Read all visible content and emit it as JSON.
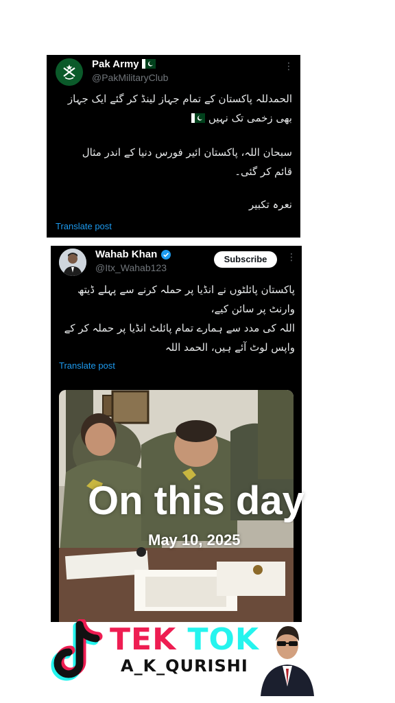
{
  "post1": {
    "name": "Pak Army",
    "handle": "@PakMilitaryClub",
    "line1": "الحمدللہ پاکستان کے تمام جہاز لینڈ کر گئے ایک جہاز",
    "line2": "بھی زخمی تک نہیں",
    "line3": "سبحان اللہ، پاکستان ائیر فورس دنیا کے اندر مثال",
    "line4": "قائم کر گئی۔",
    "line5": "نعرہ تکبیر",
    "translate": "Translate post"
  },
  "post2": {
    "name": "Wahab Khan",
    "handle": "@Itx_Wahab123",
    "subscribe": "Subscribe",
    "line1": "پاکستان پائلٹوں نے انڈیا پر حملہ کرنے سے پہلے ڈیتھ",
    "line2": "وارنٹ پر سائن کیے،",
    "line3": "اللہ کی مدد سے ہمارے تمام پائلٹ انڈیا پر حملہ کر کے",
    "line4": "واپس لوٹ آئے ہیں، الحمد اللہ",
    "translate": "Translate post"
  },
  "overlay": {
    "title": "On this day",
    "date": "May 10, 2025"
  },
  "watermark": {
    "brand_part1": "TEK",
    "brand_part2": "TOK",
    "username": "A_K_QURISHI",
    "logo_icon": "tiktok-logo-icon"
  },
  "colors": {
    "card_bg": "#000000",
    "link": "#1d9bf0",
    "verified": "#1d9bf0",
    "muted": "#71767b",
    "tiktok_red": "#ee1d52",
    "tiktok_cyan": "#25f4ee"
  }
}
